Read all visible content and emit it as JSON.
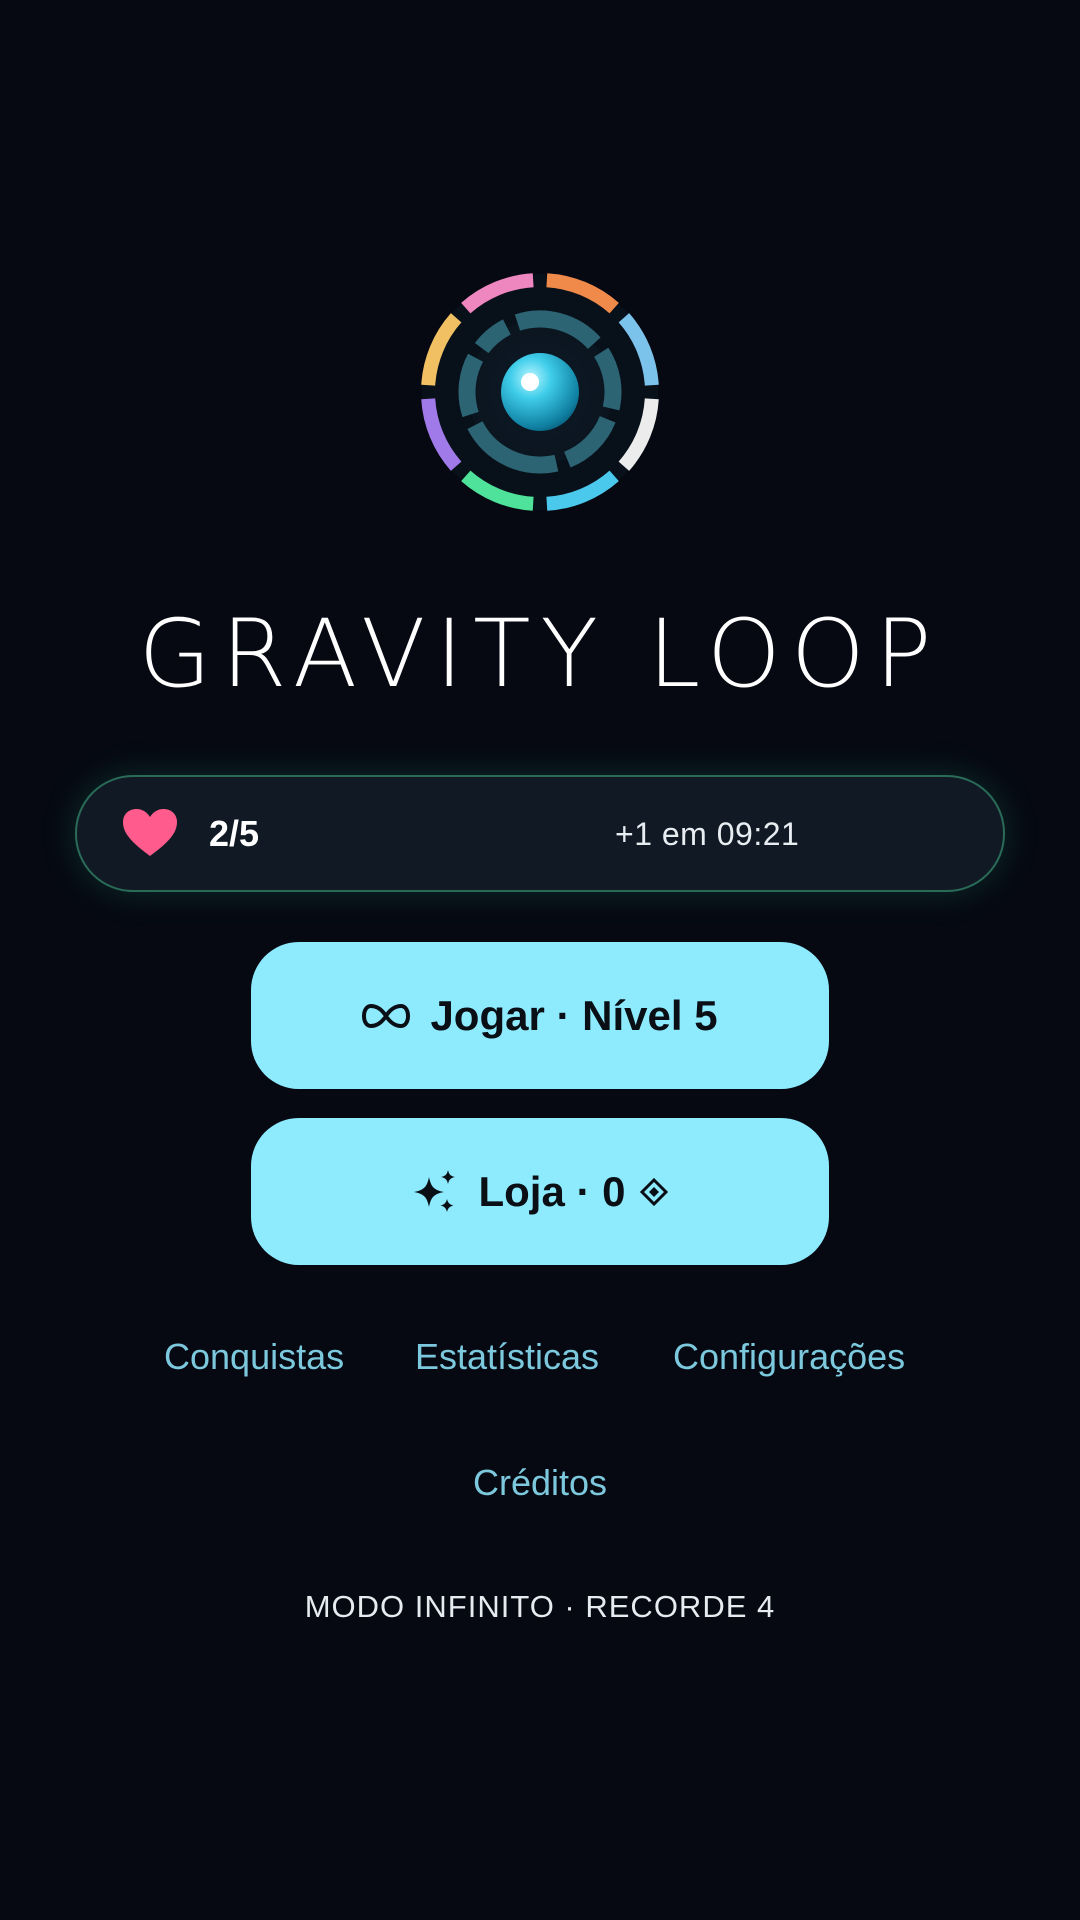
{
  "app": {
    "title": "GRAVITY LOOP",
    "logo_icon": "gravity-loop-ring-logo-icon"
  },
  "lives": {
    "icon": "heart-icon",
    "count": "2/5",
    "refill_timer": "+1 em 09:21"
  },
  "buttons": {
    "play_label": "Jogar · Nível 5",
    "play_icon": "infinity-icon",
    "shop_label": "Loja · 0",
    "shop_icon": "sparkles-icon",
    "shop_currency_icon": "gem-icon"
  },
  "links": {
    "achievements": "Conquistas",
    "statistics": "Estatísticas",
    "settings": "Configurações",
    "credits": "Créditos"
  },
  "footer": {
    "mode_record": "MODO INFINITO · RECORDE 4"
  },
  "colors": {
    "background": "#060912",
    "button_fill": "#8eebfd",
    "link_text": "#7cc8dd",
    "heart": "#ff5c8d",
    "bar_border": "#2a6b58",
    "ring_segments": [
      "#f08a4b",
      "#7cc3ec",
      "#ececec",
      "#4bc9ec",
      "#4ee29a",
      "#a07ae8",
      "#f0c063",
      "#ee86bf"
    ]
  }
}
